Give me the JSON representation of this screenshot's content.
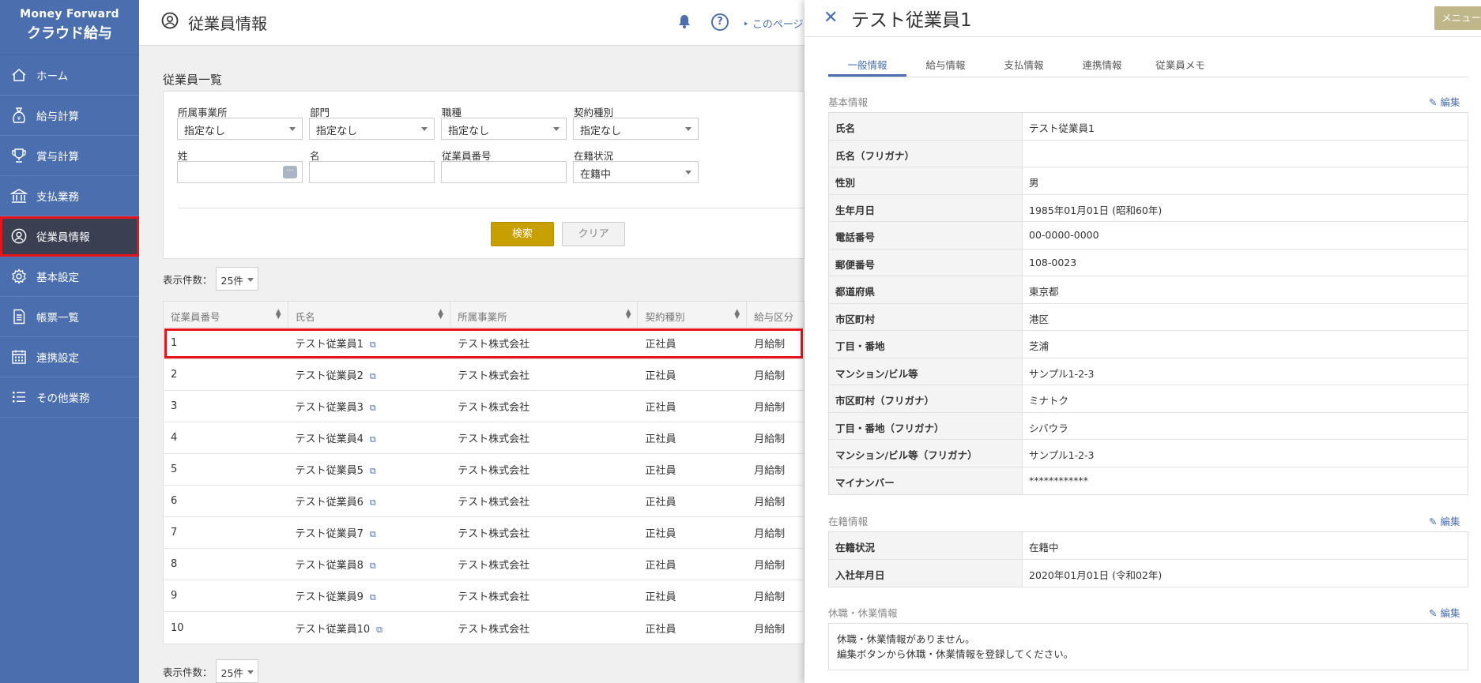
{
  "brand": {
    "line1": "Money Forward",
    "line2": "クラウド給与"
  },
  "sidebar": {
    "items": [
      {
        "label": "ホーム",
        "icon": "home-icon"
      },
      {
        "label": "給与計算",
        "icon": "money-bag-icon"
      },
      {
        "label": "賞与計算",
        "icon": "trophy-icon"
      },
      {
        "label": "支払業務",
        "icon": "bank-icon"
      },
      {
        "label": "従業員情報",
        "icon": "employee-icon",
        "active": true
      },
      {
        "label": "基本設定",
        "icon": "gear-icon"
      },
      {
        "label": "帳票一覧",
        "icon": "document-icon"
      },
      {
        "label": "連携設定",
        "icon": "calendar-grid-icon"
      },
      {
        "label": "その他業務",
        "icon": "list-icon"
      }
    ]
  },
  "header": {
    "title": "従業員情報",
    "help": "?",
    "this_page": "このページ"
  },
  "list": {
    "title": "従業員一覧",
    "filters": {
      "office_label": "所属事業所",
      "office_value": "指定なし",
      "dept_label": "部門",
      "dept_value": "指定なし",
      "position_label": "職種",
      "position_value": "指定なし",
      "contract_label": "契約種別",
      "contract_value": "指定なし",
      "last_name_label": "姓",
      "last_name_value": "",
      "first_name_label": "名",
      "first_name_value": "",
      "emp_no_label": "従業員番号",
      "emp_no_value": "",
      "status_label": "在籍状況",
      "status_value": "在籍中",
      "search_label": "検索",
      "clear_label": "クリア"
    },
    "count_label": "表示件数：",
    "count_value": "25件",
    "columns": [
      "従業員番号",
      "氏名",
      "所属事業所",
      "契約種別",
      "給与区分"
    ],
    "rows": [
      {
        "no": "1",
        "name": "テスト従業員1",
        "office": "テスト株式会社",
        "contract": "正社員",
        "pay": "月給制"
      },
      {
        "no": "2",
        "name": "テスト従業員2",
        "office": "テスト株式会社",
        "contract": "正社員",
        "pay": "月給制"
      },
      {
        "no": "3",
        "name": "テスト従業員3",
        "office": "テスト株式会社",
        "contract": "正社員",
        "pay": "月給制"
      },
      {
        "no": "4",
        "name": "テスト従業員4",
        "office": "テスト株式会社",
        "contract": "正社員",
        "pay": "月給制"
      },
      {
        "no": "5",
        "name": "テスト従業員5",
        "office": "テスト株式会社",
        "contract": "正社員",
        "pay": "月給制"
      },
      {
        "no": "6",
        "name": "テスト従業員6",
        "office": "テスト株式会社",
        "contract": "正社員",
        "pay": "月給制"
      },
      {
        "no": "7",
        "name": "テスト従業員7",
        "office": "テスト株式会社",
        "contract": "正社員",
        "pay": "月給制"
      },
      {
        "no": "8",
        "name": "テスト従業員8",
        "office": "テスト株式会社",
        "contract": "正社員",
        "pay": "月給制"
      },
      {
        "no": "9",
        "name": "テスト従業員9",
        "office": "テスト株式会社",
        "contract": "正社員",
        "pay": "月給制"
      },
      {
        "no": "10",
        "name": "テスト従業員10",
        "office": "テスト株式会社",
        "contract": "正社員",
        "pay": "月給制"
      }
    ]
  },
  "panel": {
    "title": "テスト従業員1",
    "menu_label": "メニュー",
    "tabs": [
      "一般情報",
      "給与情報",
      "支払情報",
      "連携情報",
      "従業員メモ"
    ],
    "edit_label": "編集",
    "basic": {
      "label": "基本情報",
      "rows": [
        {
          "k": "氏名",
          "v": "テスト従業員1"
        },
        {
          "k": "氏名（フリガナ）",
          "v": ""
        },
        {
          "k": "性別",
          "v": "男"
        },
        {
          "k": "生年月日",
          "v": "1985年01月01日 (昭和60年)"
        },
        {
          "k": "電話番号",
          "v": "00-0000-0000"
        },
        {
          "k": "郵便番号",
          "v": "108-0023"
        },
        {
          "k": "都道府県",
          "v": "東京都"
        },
        {
          "k": "市区町村",
          "v": "港区"
        },
        {
          "k": "丁目・番地",
          "v": "芝浦"
        },
        {
          "k": "マンション/ビル等",
          "v": "サンプル1-2-3"
        },
        {
          "k": "市区町村（フリガナ）",
          "v": "ミナトク"
        },
        {
          "k": "丁目・番地（フリガナ）",
          "v": "シバウラ"
        },
        {
          "k": "マンション/ビル等（フリガナ）",
          "v": "サンプル1-2-3"
        },
        {
          "k": "マイナンバー",
          "v": "************"
        }
      ]
    },
    "enrollment": {
      "label": "在籍情報",
      "rows": [
        {
          "k": "在籍状況",
          "v": "在籍中"
        },
        {
          "k": "入社年月日",
          "v": "2020年01月01日 (令和02年)"
        }
      ]
    },
    "leave": {
      "label": "休職・休業情報",
      "line1": "休職・休業情報がありません。",
      "line2": "編集ボタンから休職・休業情報を登録してください。"
    }
  }
}
